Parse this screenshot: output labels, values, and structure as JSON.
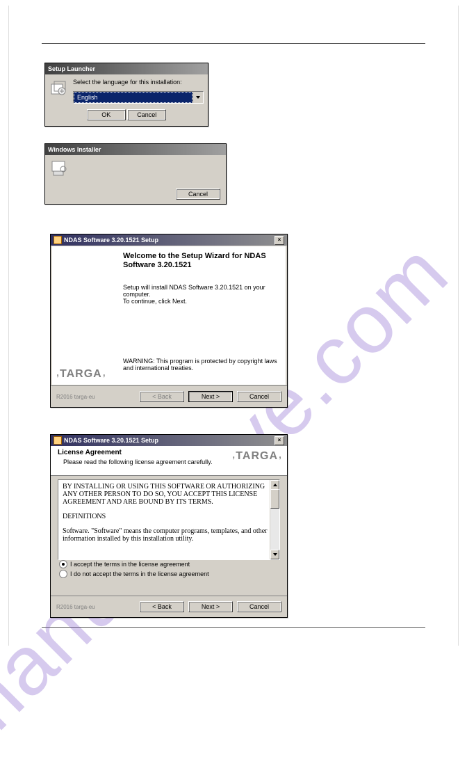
{
  "watermark": "manualshive.com",
  "setup_launcher": {
    "title": "Setup Launcher",
    "prompt": "Select the language for this installation:",
    "language": "English",
    "ok": "OK",
    "cancel": "Cancel"
  },
  "win_installer": {
    "title": "Windows Installer",
    "cancel": "Cancel"
  },
  "wizard1": {
    "title": "NDAS Software 3.20.1521 Setup",
    "heading": "Welcome to the Setup Wizard for NDAS Software 3.20.1521",
    "line1": "Setup will install NDAS Software 3.20.1521 on your computer.",
    "line2": "To continue, click Next.",
    "warn": "WARNING: This program is protected by copyright laws and international treaties.",
    "brand": "TARGA",
    "footer_left": "R2016 targa-eu",
    "back": "< Back",
    "next": "Next >",
    "cancel": "Cancel"
  },
  "wizard2": {
    "title": "NDAS Software 3.20.1521 Setup",
    "heading": "License Agreement",
    "sub": "Please read the following license agreement carefully.",
    "brand": "TARGA",
    "lic_p1": "BY INSTALLING OR USING THIS SOFTWARE OR AUTHORIZING ANY OTHER PERSON TO DO SO, YOU ACCEPT THIS LICENSE AGREEMENT AND ARE BOUND BY ITS TERMS.",
    "lic_h": "DEFINITIONS",
    "lic_p2": "Software.  \"Software\" means the computer programs, templates, and other information installed by this installation utility.",
    "opt_accept": "I accept the terms in the license agreement",
    "opt_decline": "I do not accept the terms in the license agreement",
    "footer_left": "R2016 targa-eu",
    "back": "< Back",
    "next": "Next >",
    "cancel": "Cancel"
  }
}
